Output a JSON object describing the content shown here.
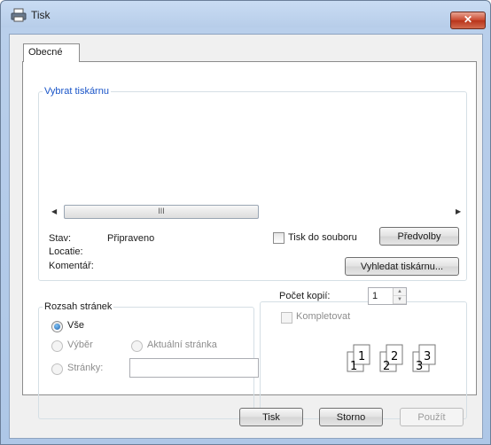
{
  "window": {
    "title": "Tisk",
    "close_label": "✕"
  },
  "tab": {
    "label": "Obecné"
  },
  "printer_group": {
    "legend": "Vybrat tiskárnu",
    "scroll_thumb": "III",
    "status_label": "Stav:",
    "status_value": "Připraveno",
    "location_label": "Locatie:",
    "comment_label": "Komentář:",
    "print_to_file_label": "Tisk do souboru",
    "preferences_button": "Předvolby",
    "find_printer_button": "Vyhledat tiskárnu..."
  },
  "range_group": {
    "legend": "Rozsah stránek",
    "all_label": "Vše",
    "selection_label": "Výběr",
    "current_page_label": "Aktuální stránka",
    "pages_label": "Stránky:",
    "pages_value": ""
  },
  "copies_group": {
    "copies_label": "Počet kopií:",
    "copies_value": "1",
    "collate_label": "Kompletovat",
    "collate_pages": [
      "1",
      "1",
      "2",
      "2",
      "3",
      "3"
    ]
  },
  "footer": {
    "print_button": "Tisk",
    "cancel_button": "Storno",
    "apply_button": "Použít"
  }
}
